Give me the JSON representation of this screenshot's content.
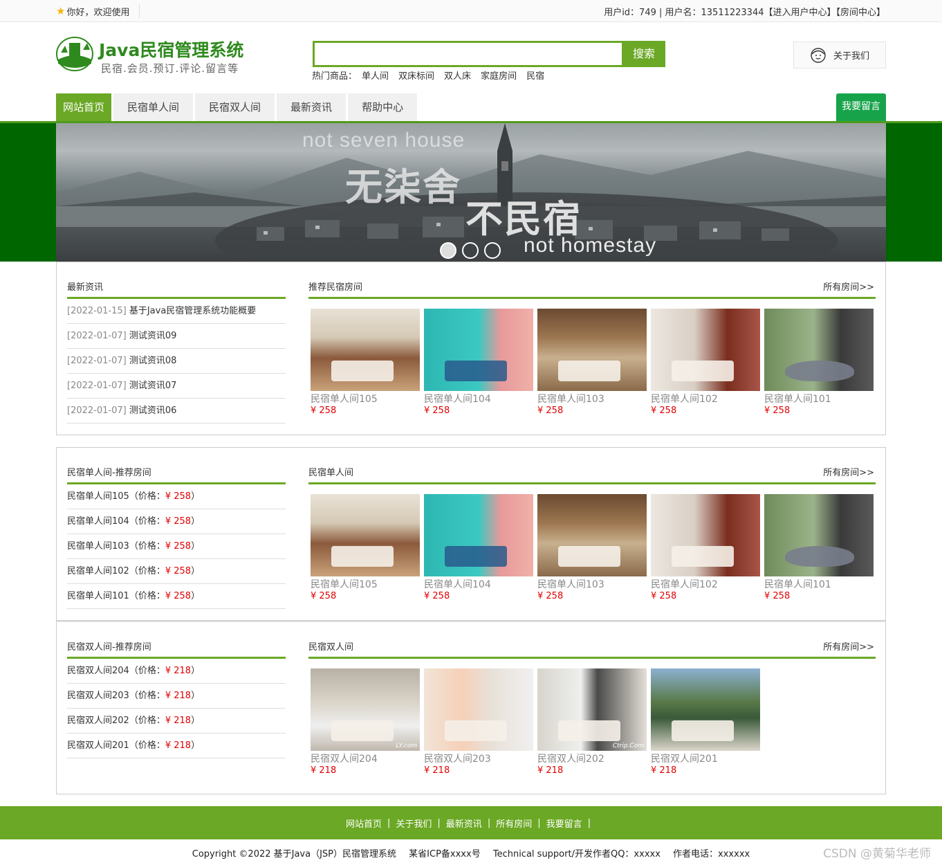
{
  "topbar": {
    "welcome": "你好，欢迎使用",
    "user_info": "用户id：749 | 用户名：13511223344【进入用户中心】【房间中心】"
  },
  "header": {
    "logo_badge": "家居民宿",
    "title": "Java民宿管理系统",
    "subtitle": "民宿.会员.预订.评论.留言等",
    "search_value": "",
    "search_button": "搜索",
    "hot_label": "热门商品：",
    "hot_items": [
      "单人间",
      "双床标间",
      "双人床",
      "家庭房间",
      "民宿"
    ],
    "about": "关于我们"
  },
  "nav": {
    "items": [
      "网站首页",
      "民宿单人间",
      "民宿双人间",
      "最新资讯",
      "帮助中心"
    ],
    "message_button": "我要留言"
  },
  "banner": {
    "en_top": "not seven house",
    "cn_line1": "无柒舍",
    "cn_line2": "不民宿",
    "en_bottom": "not homestay",
    "slides": 3,
    "active_slide": 1
  },
  "news": {
    "title": "最新资讯",
    "items": [
      {
        "date": "[2022-01-15]",
        "title": "基于Java民宿管理系统功能概要"
      },
      {
        "date": "[2022-01-07]",
        "title": "测试资讯09"
      },
      {
        "date": "[2022-01-07]",
        "title": "测试资讯08"
      },
      {
        "date": "[2022-01-07]",
        "title": "测试资讯07"
      },
      {
        "date": "[2022-01-07]",
        "title": "测试资讯06"
      }
    ]
  },
  "recommended": {
    "title": "推荐民宿房间",
    "more": "所有房间>>",
    "rooms": [
      {
        "name": "民宿单人间105",
        "price": "¥ 258"
      },
      {
        "name": "民宿单人间104",
        "price": "¥ 258"
      },
      {
        "name": "民宿单人间103",
        "price": "¥ 258"
      },
      {
        "name": "民宿单人间102",
        "price": "¥ 258"
      },
      {
        "name": "民宿单人间101",
        "price": "¥ 258"
      }
    ]
  },
  "single_side": {
    "title": "民宿单人间-推荐房间",
    "price_label": "（价格：",
    "price_close": "）",
    "items": [
      {
        "name": "民宿单人间105",
        "price": "¥ 258"
      },
      {
        "name": "民宿单人间104",
        "price": "¥ 258"
      },
      {
        "name": "民宿单人间103",
        "price": "¥ 258"
      },
      {
        "name": "民宿单人间102",
        "price": "¥ 258"
      },
      {
        "name": "民宿单人间101",
        "price": "¥ 258"
      }
    ]
  },
  "single_main": {
    "title": "民宿单人间",
    "more": "所有房间>>",
    "rooms": [
      {
        "name": "民宿单人间105",
        "price": "¥ 258"
      },
      {
        "name": "民宿单人间104",
        "price": "¥ 258"
      },
      {
        "name": "民宿单人间103",
        "price": "¥ 258"
      },
      {
        "name": "民宿单人间102",
        "price": "¥ 258"
      },
      {
        "name": "民宿单人间101",
        "price": "¥ 258"
      }
    ]
  },
  "double_side": {
    "title": "民宿双人间-推荐房间",
    "price_label": "（价格：",
    "price_close": "）",
    "items": [
      {
        "name": "民宿双人间204",
        "price": "¥ 218"
      },
      {
        "name": "民宿双人间203",
        "price": "¥ 218"
      },
      {
        "name": "民宿双人间202",
        "price": "¥ 218"
      },
      {
        "name": "民宿双人间201",
        "price": "¥ 218"
      }
    ]
  },
  "double_main": {
    "title": "民宿双人间",
    "more": "所有房间>>",
    "rooms": [
      {
        "name": "民宿双人间204",
        "price": "¥ 218",
        "watermark": "LY.com"
      },
      {
        "name": "民宿双人间203",
        "price": "¥ 218"
      },
      {
        "name": "民宿双人间202",
        "price": "¥ 218",
        "watermark": "Ctrip.Com"
      },
      {
        "name": "民宿双人间201",
        "price": "¥ 218"
      }
    ]
  },
  "footer": {
    "links": [
      "网站首页",
      "关于我们",
      "最新资讯",
      "所有房间",
      "我要留言"
    ],
    "separator": "|",
    "copyright": "Copyright ©2022 基于Java（JSP）民宿管理系统",
    "icp": "某省ICP备xxxx号",
    "support": "Technical support/开发作者QQ：xxxxx",
    "phone": "作者电话：xxxxxx",
    "watermark": "CSDN @黄菊华老师"
  },
  "colors": {
    "brand_green": "#6ba825",
    "banner_band": "#006600",
    "price_red": "#e10000",
    "title_green": "#2f8a1e"
  }
}
